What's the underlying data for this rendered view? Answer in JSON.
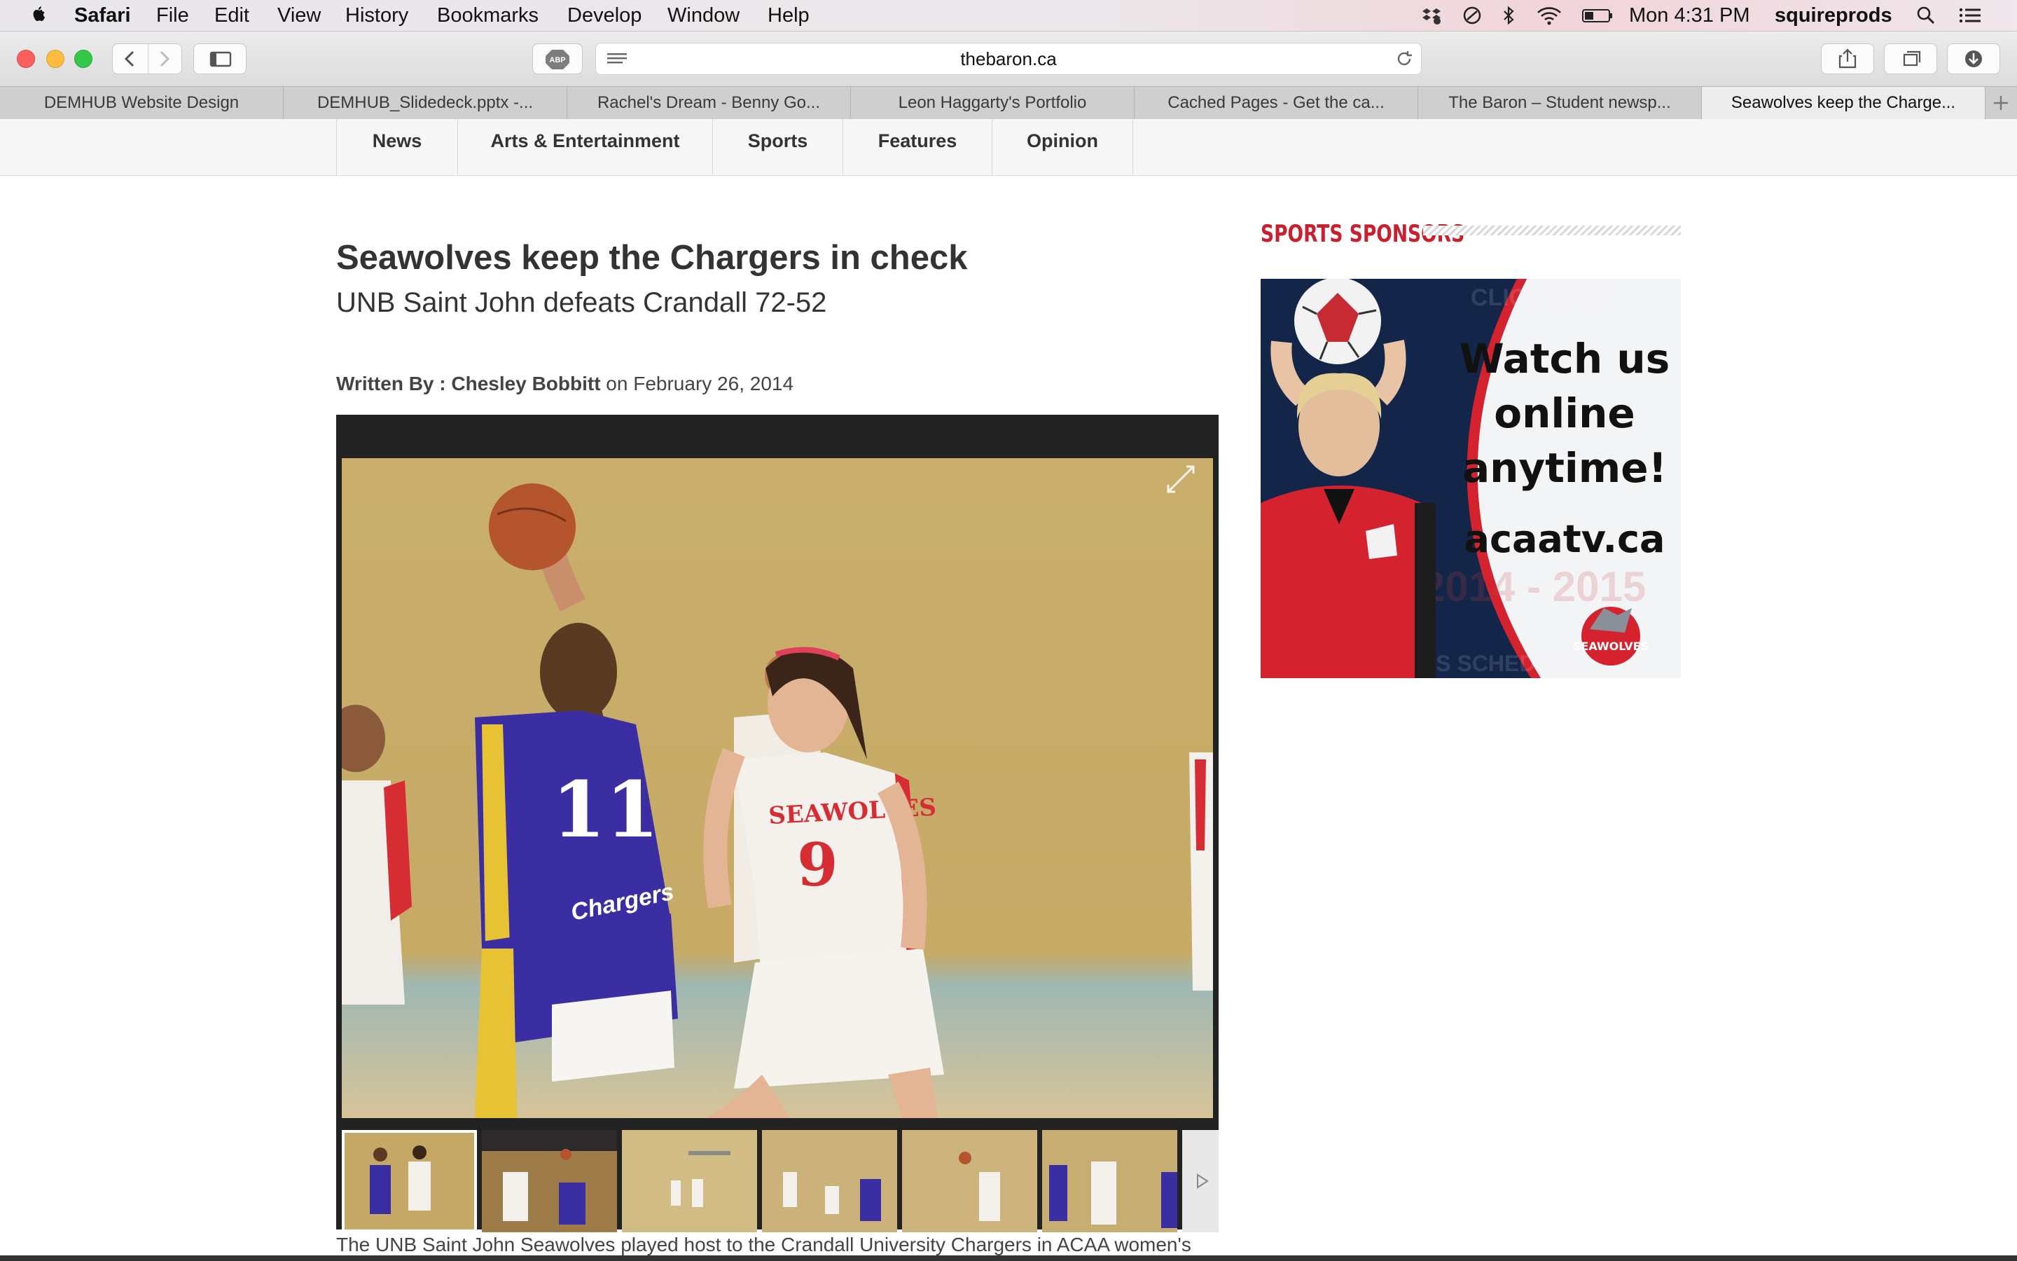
{
  "menubar": {
    "app_name": "Safari",
    "menus": [
      "File",
      "Edit",
      "View",
      "History",
      "Bookmarks",
      "Develop",
      "Window",
      "Help"
    ],
    "clock": "Mon 4:31 PM",
    "username": "squireprods"
  },
  "toolbar": {
    "url": "thebaron.ca",
    "adblock_label": "ABP"
  },
  "tabs": [
    "DEMHUB Website Design",
    "DEMHUB_Slidedeck.pptx -...",
    "Rachel's Dream - Benny Go...",
    "Leon Haggarty's Portfolio",
    "Cached Pages - Get the ca...",
    "The Baron – Student newsp...",
    "Seawolves keep the Charge..."
  ],
  "site_nav": [
    "News",
    "Arts & Entertainment",
    "Sports",
    "Features",
    "Opinion"
  ],
  "article": {
    "headline": "Seawolves keep the Chargers in check",
    "subheadline": "UNB Saint John defeats Crandall 72-52",
    "byline_prefix": "Written By : ",
    "author": "Chesley Bobbitt",
    "date_text": " on February 26, 2014",
    "body_start": "The UNB Saint John Seawolves played host to the Crandall University Chargers in ACAA women's"
  },
  "photo": {
    "jersey_left": "11",
    "jersey_right": "9",
    "team_right": "SEAWOLVES",
    "team_left": "Chargers"
  },
  "sidebar": {
    "title": "SPORTS SPONSORS",
    "ad": {
      "line1": "Watch us",
      "line2": "online",
      "line3": "anytime!",
      "line4": "acaatv.ca",
      "top_faded": "CLICK HERE",
      "bottom_faded": "SPORTS SCHEDULE",
      "year_faded": "2014 - 2015",
      "logo_text": "SEAWOLVES"
    }
  },
  "colors": {
    "accent_red": "#c8202e",
    "seawolves_red": "#d4232e",
    "chargers_blue": "#3d2f9e"
  }
}
